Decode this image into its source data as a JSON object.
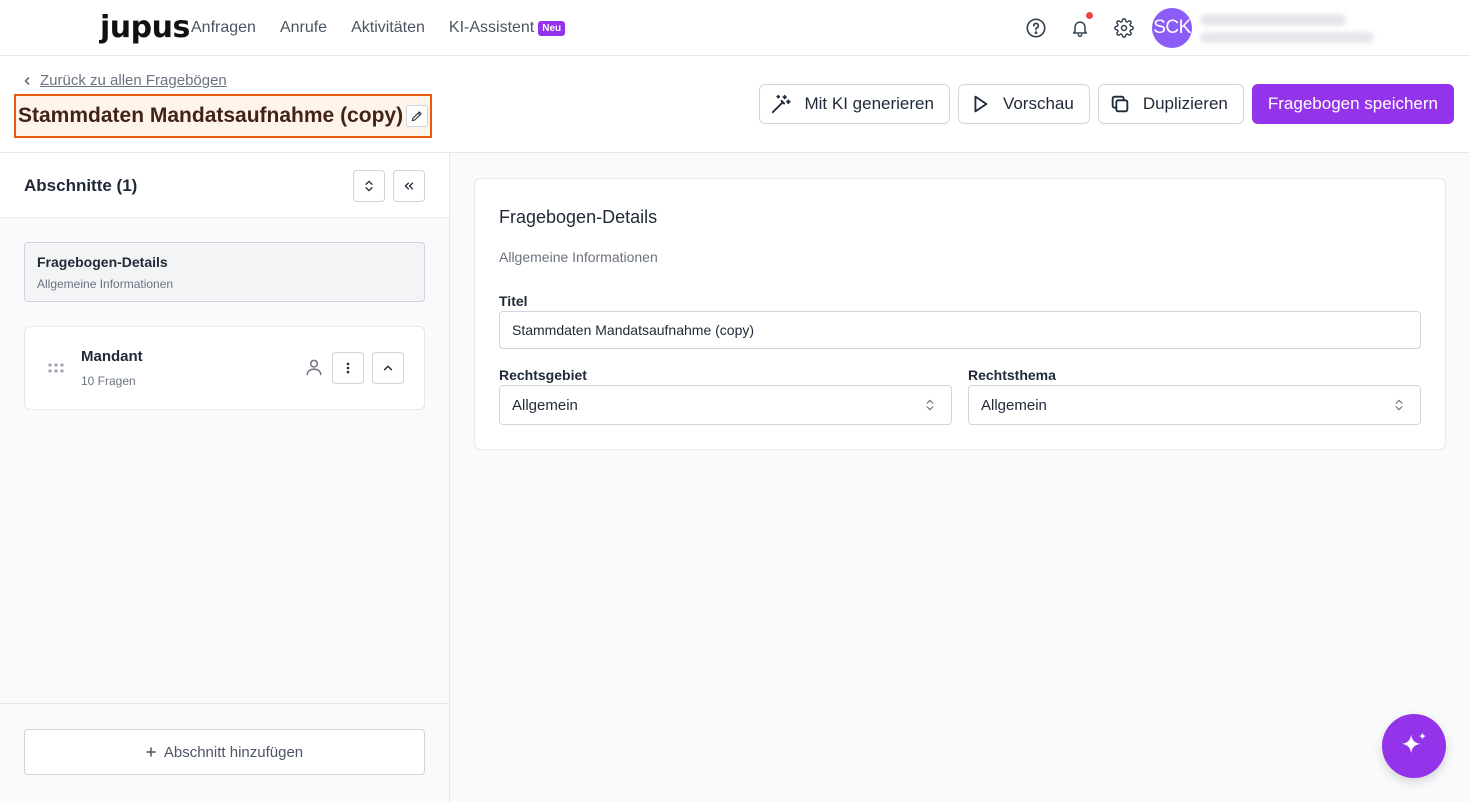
{
  "nav": {
    "logo": "jupus",
    "links": [
      "Anfragen",
      "Anrufe",
      "Aktivitäten",
      "KI-Assistent"
    ],
    "new_badge": "Neu",
    "avatar_initials": "SCK"
  },
  "header": {
    "back_label": "Zurück zu allen Fragebögen",
    "title": "Stammdaten Mandatsaufnahme (copy)",
    "actions": {
      "generate": "Mit KI generieren",
      "preview": "Vorschau",
      "duplicate": "Duplizieren",
      "save": "Fragebogen speichern"
    }
  },
  "sidebar": {
    "title": "Abschnitte (1)",
    "details_item": {
      "title": "Fragebogen-Details",
      "subtitle": "Allgemeine Informationen"
    },
    "sections": [
      {
        "title": "Mandant",
        "subtitle": "10 Fragen"
      }
    ],
    "add_section": "Abschnitt hinzufügen"
  },
  "details": {
    "title": "Fragebogen-Details",
    "subtitle": "Allgemeine Informationen",
    "title_label": "Titel",
    "title_value": "Stammdaten Mandatsaufnahme (copy)",
    "area_label": "Rechtsgebiet",
    "area_value": "Allgemein",
    "topic_label": "Rechtsthema",
    "topic_value": "Allgemein"
  },
  "colors": {
    "accent": "#9333ea",
    "title_highlight_border": "#ea580c",
    "avatar": "#8b5cf6",
    "notification": "#ef4444"
  }
}
